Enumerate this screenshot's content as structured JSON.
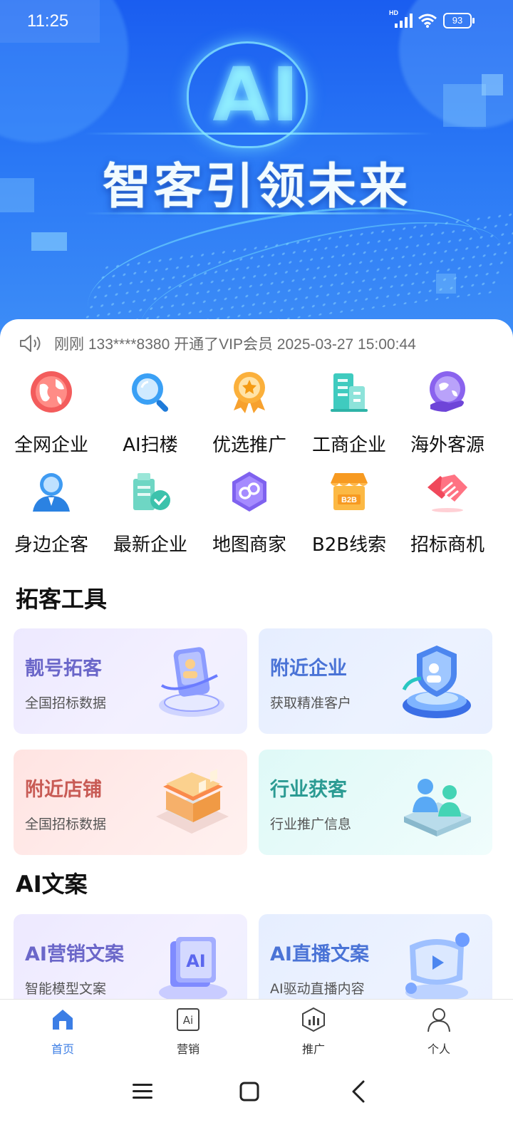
{
  "status_bar": {
    "time": "11:25",
    "network": "HD",
    "battery": "93"
  },
  "banner": {
    "ai_text": "AI",
    "slogan": "智客引领未来"
  },
  "notice": {
    "text": "刚刚 133****8380 开通了VIP会员 2025-03-27 15:00:44"
  },
  "quick_grid": [
    {
      "label": "全网企业",
      "icon": "globe-icon"
    },
    {
      "label": "AI扫楼",
      "icon": "magnifier-icon"
    },
    {
      "label": "优选推广",
      "icon": "medal-icon"
    },
    {
      "label": "工商企业",
      "icon": "building-icon"
    },
    {
      "label": "海外客源",
      "icon": "world-hand-icon"
    },
    {
      "label": "身边企客",
      "icon": "person-icon"
    },
    {
      "label": "最新企业",
      "icon": "new-building-icon"
    },
    {
      "label": "地图商家",
      "icon": "map-hexagon-icon"
    },
    {
      "label": "B2B线索",
      "icon": "b2b-store-icon"
    },
    {
      "label": "招标商机",
      "icon": "handshake-icon"
    }
  ],
  "b2b_badge": "B2B",
  "sections": {
    "tools_title": "拓客工具",
    "ai_title": "AI文案"
  },
  "tool_cards": [
    {
      "title": "靓号拓客",
      "subtitle": "全国招标数据",
      "icon": "phone-card-icon"
    },
    {
      "title": "附近企业",
      "subtitle": "获取精准客户",
      "icon": "shield-icon"
    },
    {
      "title": "附近店铺",
      "subtitle": "全国招标数据",
      "icon": "shop-icon"
    },
    {
      "title": "行业获客",
      "subtitle": "行业推广信息",
      "icon": "people-platform-icon"
    }
  ],
  "ai_cards": [
    {
      "title": "AI营销文案",
      "subtitle": "智能模型文案",
      "icon": "ai-cube-icon",
      "icon_text": "AI"
    },
    {
      "title": "AI直播文案",
      "subtitle": "AI驱动直播内容",
      "icon": "live-monitor-icon"
    }
  ],
  "bottom_nav": [
    {
      "label": "首页",
      "icon": "home-icon",
      "active": true
    },
    {
      "label": "营销",
      "icon": "ai-box-icon",
      "icon_text": "Ai",
      "active": false
    },
    {
      "label": "推广",
      "icon": "hexagon-chart-icon",
      "active": false
    },
    {
      "label": "个人",
      "icon": "user-icon",
      "active": false
    }
  ],
  "colors": {
    "accent": "#3c7ee5",
    "banner_top": "#1a5df0",
    "banner_bottom": "#3f8ff7"
  }
}
